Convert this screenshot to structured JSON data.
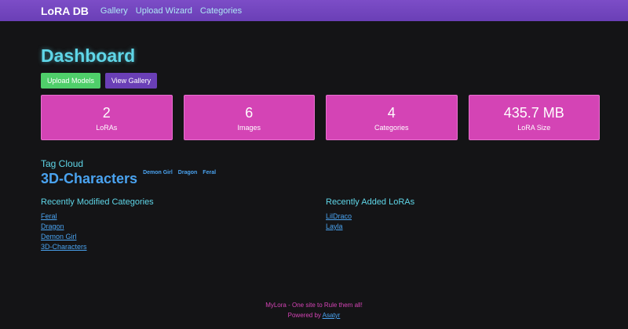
{
  "nav": {
    "brand": "LoRA DB",
    "links": [
      "Gallery",
      "Upload Wizard",
      "Categories"
    ]
  },
  "dashboard": {
    "title": "Dashboard",
    "upload_button": "Upload Models",
    "gallery_button": "View Gallery"
  },
  "stats": [
    {
      "value": "2",
      "label": "LoRAs"
    },
    {
      "value": "6",
      "label": "Images"
    },
    {
      "value": "4",
      "label": "Categories"
    },
    {
      "value": "435.7 MB",
      "label": "LoRA Size"
    }
  ],
  "tag_cloud": {
    "title": "Tag Cloud",
    "big_tag": "3D-Characters",
    "small_tags": [
      "Demon Girl",
      "Dragon",
      "Feral"
    ]
  },
  "recent_categories": {
    "title": "Recently Modified Categories",
    "items": [
      "Feral",
      "Dragon",
      "Demon Girl",
      "3D-Characters"
    ]
  },
  "recent_loras": {
    "title": "Recently Added LoRAs",
    "items": [
      "LilDraco",
      "Layla"
    ]
  },
  "footer": {
    "line1": "MyLora - One site to Rule them all!",
    "powered_prefix": "Powered by ",
    "powered_link": "Asatyr"
  },
  "colors": {
    "navbar": "#6a3fb6",
    "accent_cyan": "#5fd6e8",
    "card_pink": "#d444b5",
    "link_blue": "#4aa3f0",
    "button_green": "#4fcf6a"
  }
}
